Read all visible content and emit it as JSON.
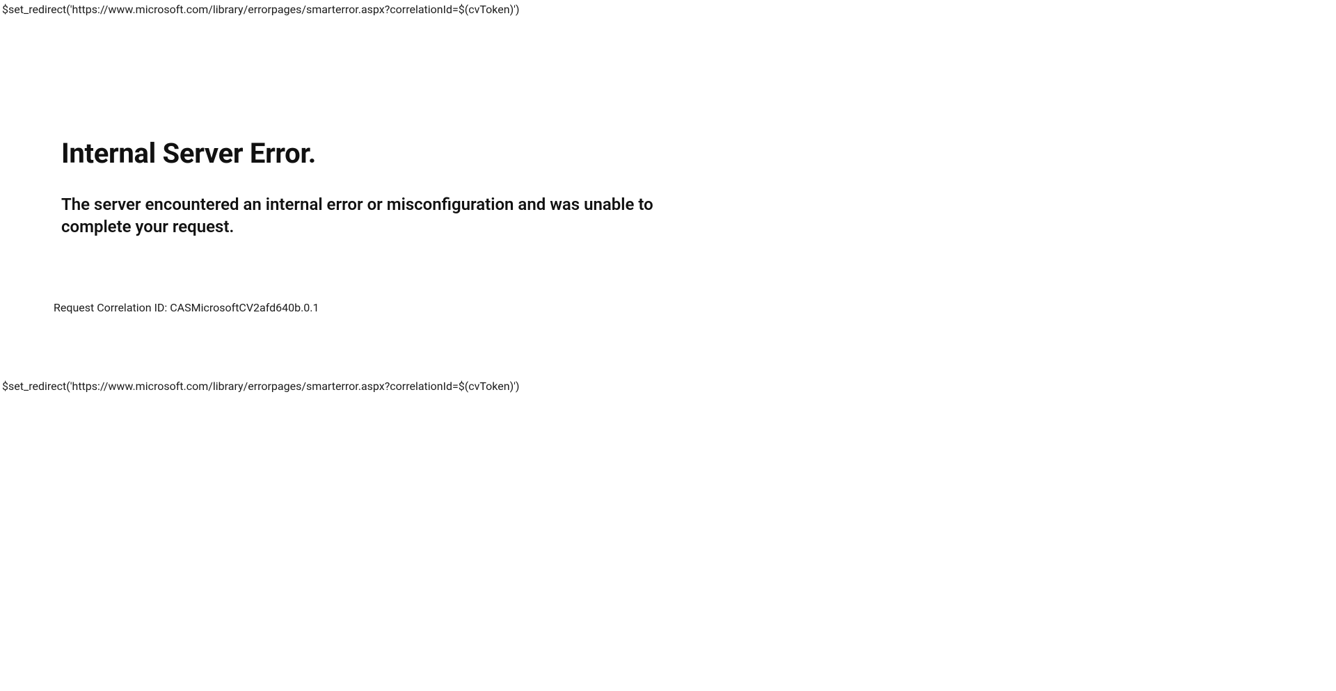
{
  "raw": {
    "top_text": "$set_redirect('https://www.microsoft.com/library/errorpages/smarterror.aspx?correlationId=$(cvToken)')",
    "bottom_text": "$set_redirect('https://www.microsoft.com/library/errorpages/smarterror.aspx?correlationId=$(cvToken)')"
  },
  "error": {
    "heading": "Internal Server Error.",
    "subheading": "The server encountered an internal error or misconfiguration and was unable to complete your request.",
    "correlation_label": "Request Correlation ID: CASMicrosoftCV2afd640b.0.1"
  }
}
